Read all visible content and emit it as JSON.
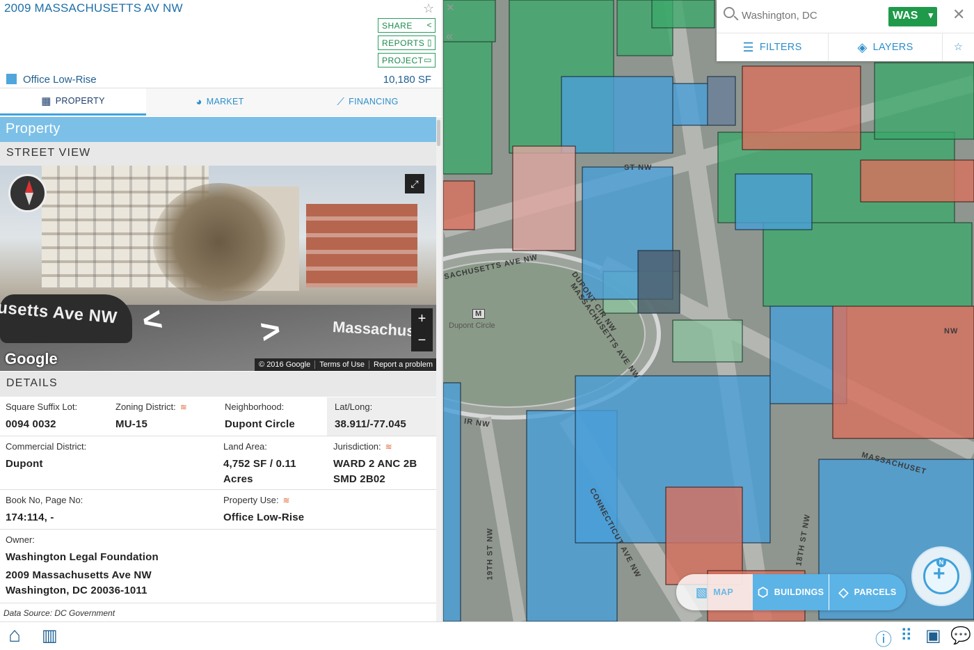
{
  "property": {
    "address": "2009 MASSACHUSETTS AV NW",
    "use_type": "Office Low-Rise",
    "area": "10,180 SF",
    "use_color": "#4fa6dc"
  },
  "actions": {
    "share": "SHARE",
    "reports": "REPORTS",
    "project": "PROJECT"
  },
  "tabs": [
    {
      "label": "PROPERTY",
      "icon": "building-icon",
      "active": true
    },
    {
      "label": "MARKET",
      "icon": "pie-chart-icon",
      "active": false
    },
    {
      "label": "FINANCING",
      "icon": "line-chart-icon",
      "active": false
    }
  ],
  "section_title": "Property",
  "street_view": {
    "heading": "STREET VIEW",
    "road_name_left": "usetts Ave NW",
    "road_name_right": "Massachus",
    "logo": "Google",
    "copyright": "© 2016 Google",
    "terms": "Terms of Use",
    "report": "Report a problem",
    "zoom_in": "+",
    "zoom_out": "−"
  },
  "details": {
    "heading": "DETAILS",
    "square_suffix_lot": {
      "label": "Square Suffix Lot:",
      "value": "0094 0032"
    },
    "zoning_district": {
      "label": "Zoning District:",
      "value": "MU-15"
    },
    "neighborhood": {
      "label": "Neighborhood:",
      "value": "Dupont Circle"
    },
    "lat_long": {
      "label": "Lat/Long:",
      "value": "38.911/-77.045"
    },
    "commercial_district": {
      "label": "Commercial District:",
      "value": "Dupont"
    },
    "land_area": {
      "label": "Land Area:",
      "value": "4,752 SF / 0.11 Acres"
    },
    "jurisdiction": {
      "label": "Jurisdiction:",
      "value": "WARD 2 ANC 2B SMD 2B02"
    },
    "book_page": {
      "label": "Book No, Page No:",
      "value": "174:114, -"
    },
    "property_use": {
      "label": "Property Use:",
      "value": "Office Low-Rise"
    },
    "owner": {
      "label": "Owner:",
      "name": "Washington Legal Foundation",
      "street": "2009 Massachusetts Ave NW",
      "city": "Washington, DC 20036-1011"
    },
    "data_source": "Data Source: DC Government"
  },
  "map": {
    "search_placeholder": "Washington, DC",
    "market_code": "WAS",
    "filters": "FILTERS",
    "layers": "LAYERS",
    "modes": [
      {
        "label": "MAP",
        "icon": "map-icon",
        "active": false
      },
      {
        "label": "BUILDINGS",
        "icon": "cube-icon",
        "active": true
      },
      {
        "label": "PARCELS",
        "icon": "parcel-icon",
        "active": true
      }
    ],
    "compass_north": "N",
    "street_labels": [
      "ST NW",
      "SACHUSETTS AVE NW",
      "DUPONT CIR NW",
      "MASSACHUSETTS AVE NW",
      "IR NW",
      "CONNECTICUT AVE NW",
      "19TH ST NW",
      "18TH ST NW",
      "MASSACHUSET",
      "NW"
    ],
    "station_label": "M",
    "station_name": "Dupont Circle",
    "colors": {
      "residential": "#3aa86a",
      "office": "#4a9fd8",
      "retail": "#d9705e",
      "accent": "#2c8fcb",
      "brand_green": "#1f9a4a"
    }
  }
}
